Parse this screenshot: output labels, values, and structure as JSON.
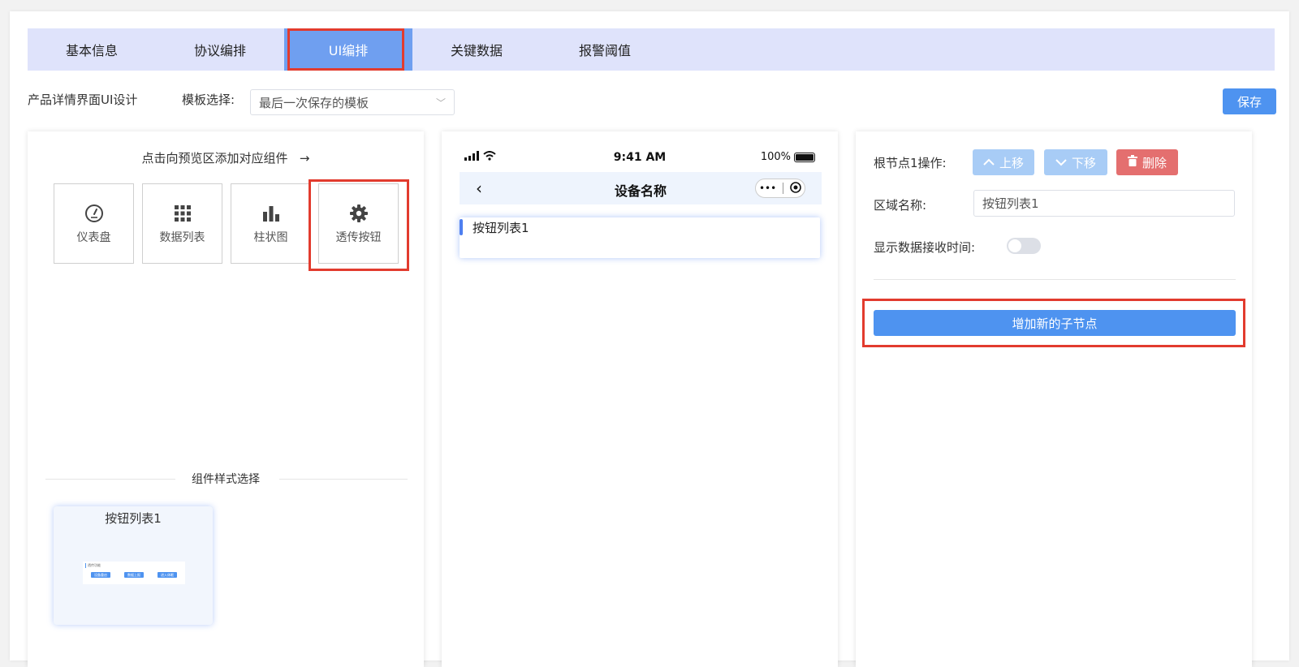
{
  "tabs": [
    {
      "label": "基本信息"
    },
    {
      "label": "协议编排"
    },
    {
      "label": "UI编排"
    },
    {
      "label": "关键数据"
    },
    {
      "label": "报警阈值"
    }
  ],
  "toolbar": {
    "title": "产品详情界面UI设计",
    "template_label": "模板选择:",
    "template_value": "最后一次保存的模板",
    "save_label": "保存"
  },
  "left_panel": {
    "hint": "点击向预览区添加对应组件",
    "hint_arrow": "→",
    "components": [
      {
        "label": "仪表盘",
        "icon": "gauge-icon"
      },
      {
        "label": "数据列表",
        "icon": "grid-icon"
      },
      {
        "label": "柱状图",
        "icon": "bar-chart-icon"
      },
      {
        "label": "透传按钮",
        "icon": "gear-icon"
      }
    ],
    "style_section": "组件样式选择",
    "style_card": {
      "title": "按钮列表1",
      "mini_title": "透传功能",
      "mini_buttons": [
        "设备重启",
        "数据上报",
        "进入休眠"
      ]
    }
  },
  "preview": {
    "time": "9:41 AM",
    "battery": "100%",
    "nav_title": "设备名称",
    "capsule_more": "•••",
    "item_title": "按钮列表1"
  },
  "right_panel": {
    "op_label": "根节点1操作:",
    "up_label": "上移",
    "down_label": "下移",
    "delete_label": "删除",
    "name_label": "区域名称:",
    "name_value": "按钮列表1",
    "show_time_label": "显示数据接收时间:",
    "show_time_enabled": false,
    "add_child_label": "增加新的子节点"
  },
  "colors": {
    "accent": "#4e93f0",
    "tab_bar": "#dfe3fb",
    "tab_active": "#6f9ff0",
    "highlight": "#e23b2e",
    "danger": "#e46f6f"
  }
}
